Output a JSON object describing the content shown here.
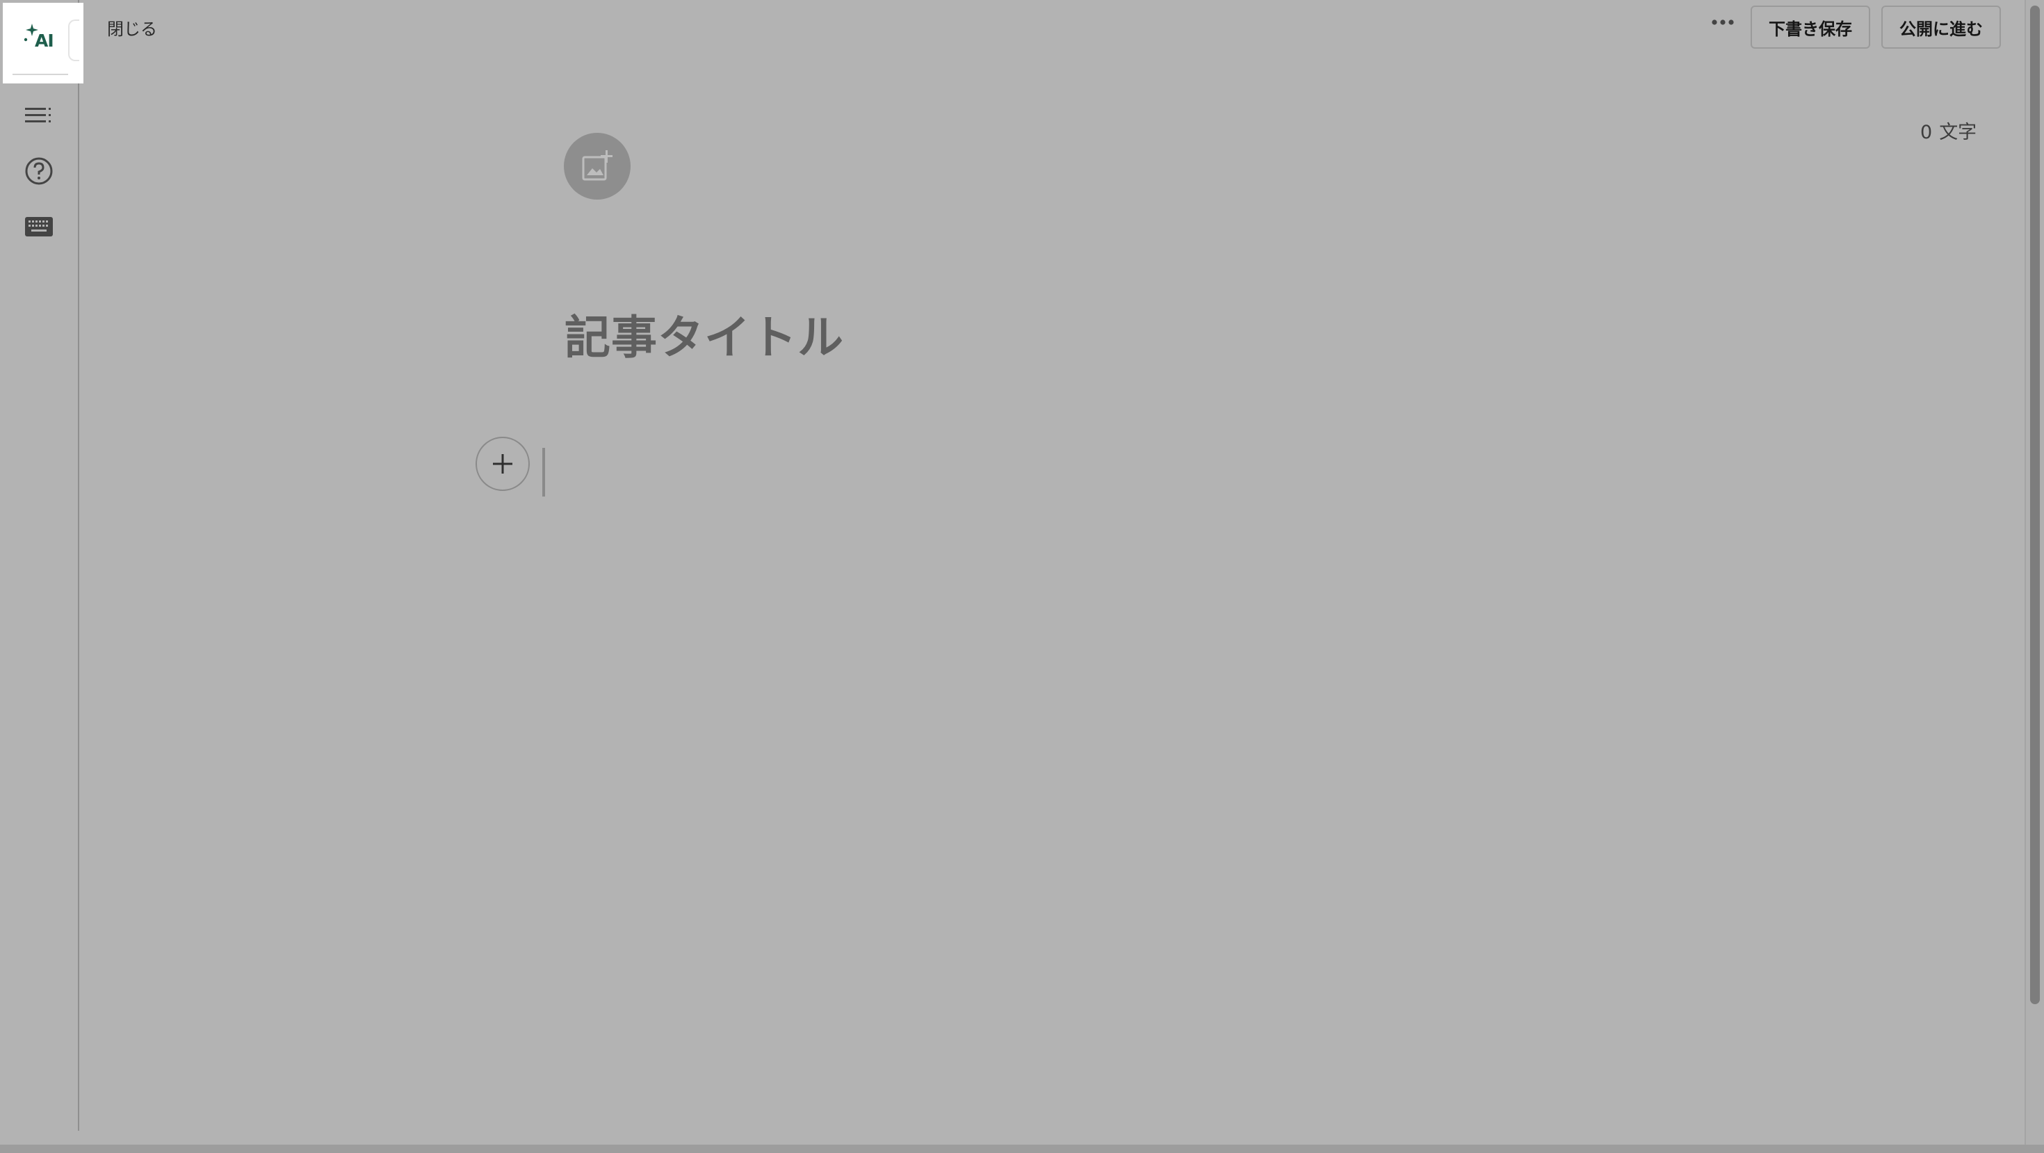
{
  "top_bar": {
    "close_label": "閉じる",
    "more_icon": "ellipsis-icon",
    "save_draft_label": "下書き保存",
    "publish_label": "公開に進む"
  },
  "sidebar": {
    "ai_label": "AI",
    "items": [
      {
        "icon": "table-of-contents-icon"
      },
      {
        "icon": "help-circle-icon"
      },
      {
        "icon": "keyboard-icon"
      }
    ]
  },
  "editor": {
    "char_count_value": "0",
    "char_count_unit": "文字",
    "cover_image_icon": "add-image-icon",
    "title_placeholder": "記事タイトル",
    "add_block_icon": "plus-icon"
  },
  "colors": {
    "overlay": "#b3b3b3",
    "ai_accent": "#1e5e4c",
    "button_border": "#9a9a9a"
  }
}
